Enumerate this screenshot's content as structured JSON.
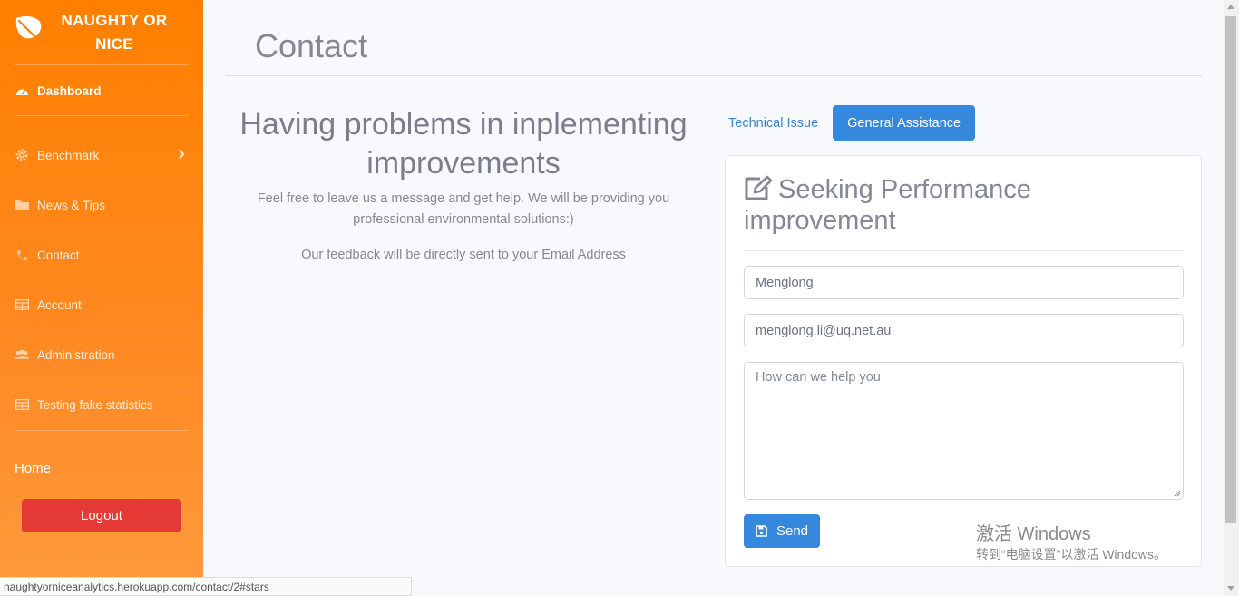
{
  "sidebar": {
    "brand": "NAUGHTY OR NICE",
    "dashboard_label": "Dashboard",
    "items": [
      {
        "label": "Benchmark",
        "icon": "gear-icon"
      },
      {
        "label": "News & Tips",
        "icon": "folder-icon"
      },
      {
        "label": "Contact",
        "icon": "phone-icon"
      },
      {
        "label": "Account",
        "icon": "table-icon"
      },
      {
        "label": "Administration",
        "icon": "users-icon"
      },
      {
        "label": "Testing fake statistics",
        "icon": "table-icon"
      }
    ],
    "home_label": "Home",
    "logout_label": "Logout"
  },
  "main": {
    "page_title": "Contact",
    "heading": "Having problems in inplementing improvements",
    "paragraph1": "Feel free to leave us a message and get help. We will be providing you professional environmental solutions:)",
    "paragraph2": "Our feedback will be directly sent to your Email Address",
    "tabs": [
      {
        "label": "Technical Issue",
        "active": false
      },
      {
        "label": "General Assistance",
        "active": true
      }
    ],
    "form": {
      "heading": "Seeking Performance improvement",
      "name_value": "Menglong",
      "email_value": "menglong.li@uq.net.au",
      "message_placeholder": "How can we help you",
      "send_label": "Send"
    }
  },
  "watermark": {
    "line1": "激活 Windows",
    "line2": "转到“电脑设置”以激活 Windows。"
  },
  "statusbar": {
    "url": "naughtyorniceanalytics.herokuapp.com/contact/2#stars"
  },
  "colors": {
    "sidebar": "#ff8000",
    "primary": "#3588db",
    "logout": "#e53935"
  }
}
